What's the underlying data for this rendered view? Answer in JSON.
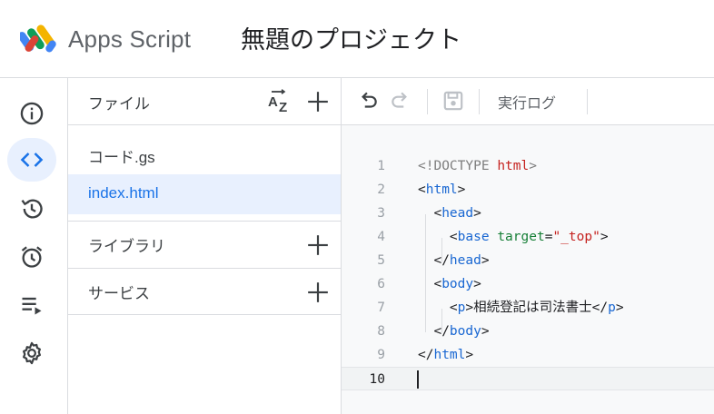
{
  "header": {
    "app_name": "Apps Script",
    "project_title": "無題のプロジェクト"
  },
  "rail": [
    {
      "icon": "info-icon",
      "active": false
    },
    {
      "icon": "code-icon",
      "active": true
    },
    {
      "icon": "history-icon",
      "active": false
    },
    {
      "icon": "alarm-icon",
      "active": false
    },
    {
      "icon": "executions-icon",
      "active": false
    },
    {
      "icon": "gear-icon",
      "active": false
    }
  ],
  "files_panel": {
    "title": "ファイル",
    "files": [
      {
        "name": "コード.gs",
        "selected": false
      },
      {
        "name": "index.html",
        "selected": true
      }
    ],
    "sections": [
      {
        "label": "ライブラリ"
      },
      {
        "label": "サービス"
      }
    ]
  },
  "toolbar": {
    "run_log_label": "実行ログ"
  },
  "editor": {
    "current_line": 10,
    "lines": [
      {
        "n": "1",
        "tokens": [
          {
            "t": "<!DOCTYPE ",
            "c": "gray"
          },
          {
            "t": "html",
            "c": "str"
          },
          {
            "t": ">",
            "c": "gray"
          }
        ]
      },
      {
        "n": "2",
        "tokens": [
          {
            "t": "<",
            "c": "dark"
          },
          {
            "t": "html",
            "c": "tag"
          },
          {
            "t": ">",
            "c": "dark"
          }
        ]
      },
      {
        "n": "3",
        "tokens": [
          {
            "t": "  <",
            "c": "dark"
          },
          {
            "t": "head",
            "c": "tag"
          },
          {
            "t": ">",
            "c": "dark"
          }
        ]
      },
      {
        "n": "4",
        "tokens": [
          {
            "t": "    <",
            "c": "dark"
          },
          {
            "t": "base",
            "c": "tag"
          },
          {
            "t": " ",
            "c": "dark"
          },
          {
            "t": "target",
            "c": "attr"
          },
          {
            "t": "=",
            "c": "dark"
          },
          {
            "t": "\"_top\"",
            "c": "str"
          },
          {
            "t": ">",
            "c": "dark"
          }
        ]
      },
      {
        "n": "5",
        "tokens": [
          {
            "t": "  </",
            "c": "dark"
          },
          {
            "t": "head",
            "c": "tag"
          },
          {
            "t": ">",
            "c": "dark"
          }
        ]
      },
      {
        "n": "6",
        "tokens": [
          {
            "t": "  <",
            "c": "dark"
          },
          {
            "t": "body",
            "c": "tag"
          },
          {
            "t": ">",
            "c": "dark"
          }
        ]
      },
      {
        "n": "7",
        "tokens": [
          {
            "t": "    <",
            "c": "dark"
          },
          {
            "t": "p",
            "c": "tag"
          },
          {
            "t": ">相続登記は司法書士</",
            "c": "dark"
          },
          {
            "t": "p",
            "c": "tag"
          },
          {
            "t": ">",
            "c": "dark"
          }
        ]
      },
      {
        "n": "8",
        "tokens": [
          {
            "t": "  </",
            "c": "dark"
          },
          {
            "t": "body",
            "c": "tag"
          },
          {
            "t": ">",
            "c": "dark"
          }
        ]
      },
      {
        "n": "9",
        "tokens": [
          {
            "t": "</",
            "c": "dark"
          },
          {
            "t": "html",
            "c": "tag"
          },
          {
            "t": ">",
            "c": "dark"
          }
        ]
      },
      {
        "n": "10",
        "tokens": []
      }
    ]
  }
}
